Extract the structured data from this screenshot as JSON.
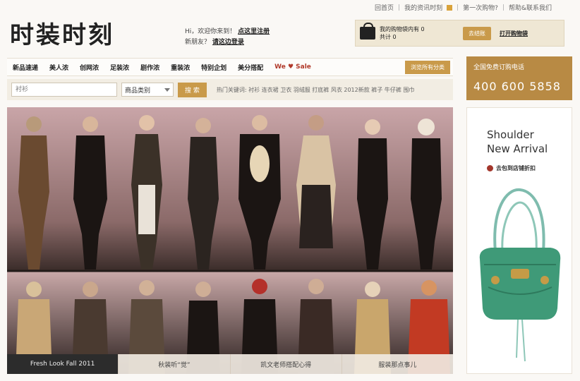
{
  "top_links": [
    "回首页",
    "我的资讯时刻",
    "第一次购物?",
    "帮助&联系我们"
  ],
  "logo": "时装时刻",
  "greeting": {
    "line1_prefix": "Hi，欢迎你来到！",
    "line1_link": "点这里注册",
    "line2_prefix": "新朋友？",
    "line2_link": "请这边登录"
  },
  "cart": {
    "text_line1": "我的购物袋内有 0",
    "text_line2": "共计 0",
    "checkout_label": "去结账",
    "open_label": "打开购物袋"
  },
  "nav": {
    "items": [
      "新品速递",
      "美人浓",
      "创网浓",
      "足装浓",
      "剧作浓",
      "重装浓",
      "特别企划",
      "美分搭配"
    ],
    "sale_label": "We ♥ Sale",
    "all_label": "浏览所有分类"
  },
  "phone": {
    "label": "全国免费订购电话",
    "number": "400 600 5858"
  },
  "search": {
    "placeholder": "衬衫",
    "category_label": "商品类别",
    "button_label": "搜 索",
    "hot_text": "热门关键词: 衬衫  连衣裙  卫衣  羽绒服  打底裤  风衣  2012新款  裤子  牛仔裤  围巾"
  },
  "banner": {
    "tabs": [
      "Fresh Look Fall 2011",
      "秋装听“觉”",
      "凯文老师搭配心得",
      "服装那点事儿"
    ]
  },
  "side_ad": {
    "line1": "Shoulder",
    "line2": "New Arrival",
    "shop_label": "去包到店铺折扣"
  },
  "colors": {
    "accent_gold": "#c99a4a",
    "phone_bg": "#b88a44",
    "sale_red": "#b13a2b"
  }
}
